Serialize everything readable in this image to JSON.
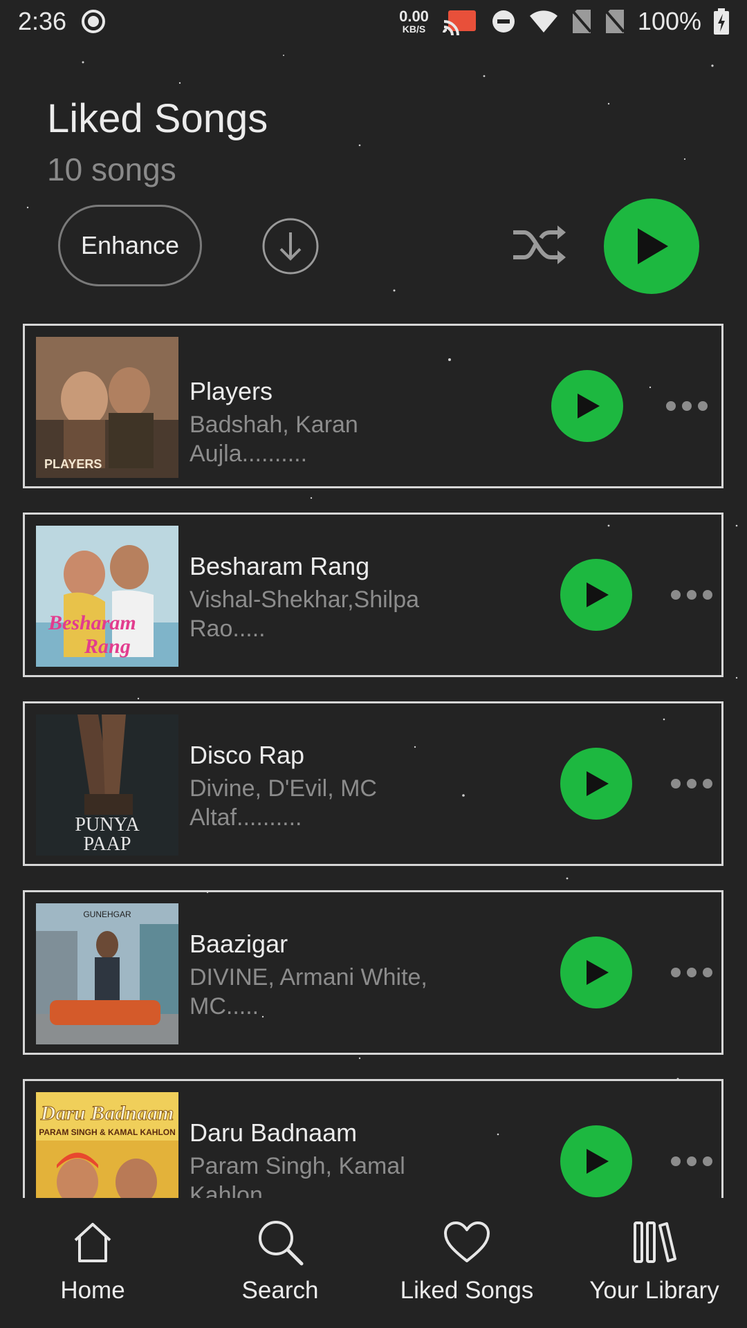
{
  "status_bar": {
    "time": "2:36",
    "net_speed_value": "0.00",
    "net_speed_unit": "KB/S",
    "battery": "100%"
  },
  "header": {
    "title": "Liked Songs",
    "count": "10 songs",
    "enhance_label": "Enhance"
  },
  "songs": [
    {
      "title": "Players",
      "artists_line1": "Badshah, Karan Aujla..........",
      "artists_line2": "",
      "art_text": "PLAYERS"
    },
    {
      "title": "Besharam Rang",
      "artists_line1": "Vishal-Shekhar,Shilpa",
      "artists_line2": "Rao.....",
      "art_text": "Besharam Rang"
    },
    {
      "title": "Disco Rap",
      "artists_line1": "Divine, D'Evil, MC",
      "artists_line2": "Altaf..........",
      "art_text": "PUNYA PAAP"
    },
    {
      "title": "Baazigar",
      "artists_line1": "DIVINE, Armani White,",
      "artists_line2": "MC.....",
      "art_text": "GUNEHGAR"
    },
    {
      "title": "Daru Badnaam",
      "artists_line1": "Param Singh, Kamal",
      "artists_line2": "Kahlon",
      "art_text": "Daru Badnaam"
    }
  ],
  "nav": {
    "home": "Home",
    "search": "Search",
    "liked": "Liked Songs",
    "library": "Your Library"
  },
  "colors": {
    "accent": "#1db840",
    "background": "#232323"
  }
}
